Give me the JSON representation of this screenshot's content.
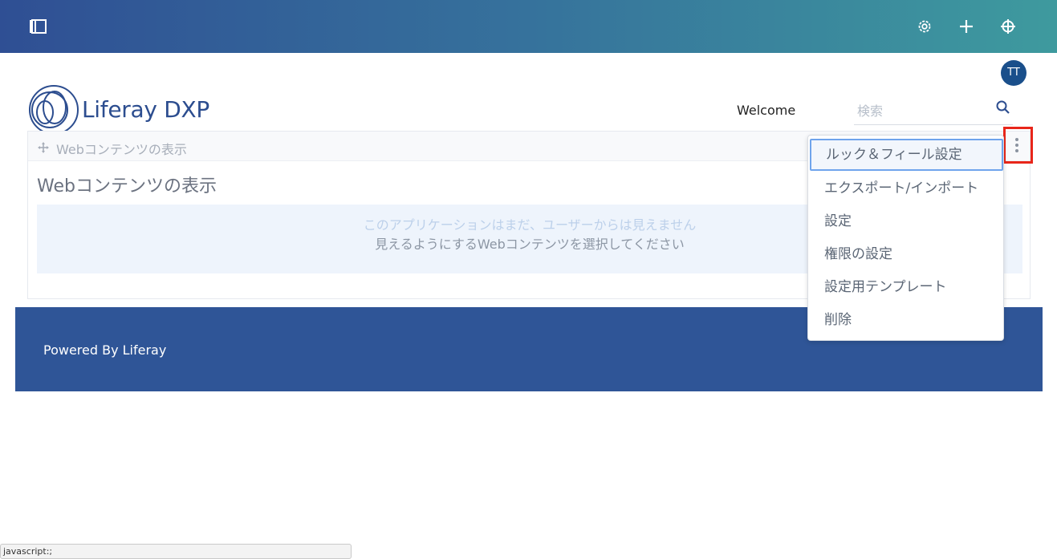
{
  "topbar": {
    "panel_icon": "sidebar-panel-icon",
    "settings_icon": "gear-icon",
    "add_icon": "plus-icon",
    "simulation_icon": "simulation-icon"
  },
  "user": {
    "avatar_initials": "TT"
  },
  "site": {
    "logo_text": "Liferay DXP"
  },
  "nav": {
    "welcome_label": "Welcome"
  },
  "search": {
    "placeholder": "検索",
    "icon": "search-icon"
  },
  "portlet": {
    "top_title": "Webコンテンツの表示",
    "title": "Webコンテンツの表示",
    "info_line1": "このアプリケーションはまだ、ユーザーからは見えません",
    "info_line2": "見えるようにするWebコンテンツを選択してください"
  },
  "menu": {
    "items": [
      {
        "label": "ルック＆フィール設定"
      },
      {
        "label": "エクスポート/インポート"
      },
      {
        "label": "設定"
      },
      {
        "label": "権限の設定"
      },
      {
        "label": "設定用テンプレート"
      },
      {
        "label": "削除"
      }
    ]
  },
  "footer": {
    "text": "Powered By Liferay"
  },
  "statusbar": {
    "text": "javascript:;"
  },
  "colors": {
    "highlight": "#e8261a",
    "footer_bg": "#2f5597",
    "avatar_bg": "#1a4f8b"
  }
}
